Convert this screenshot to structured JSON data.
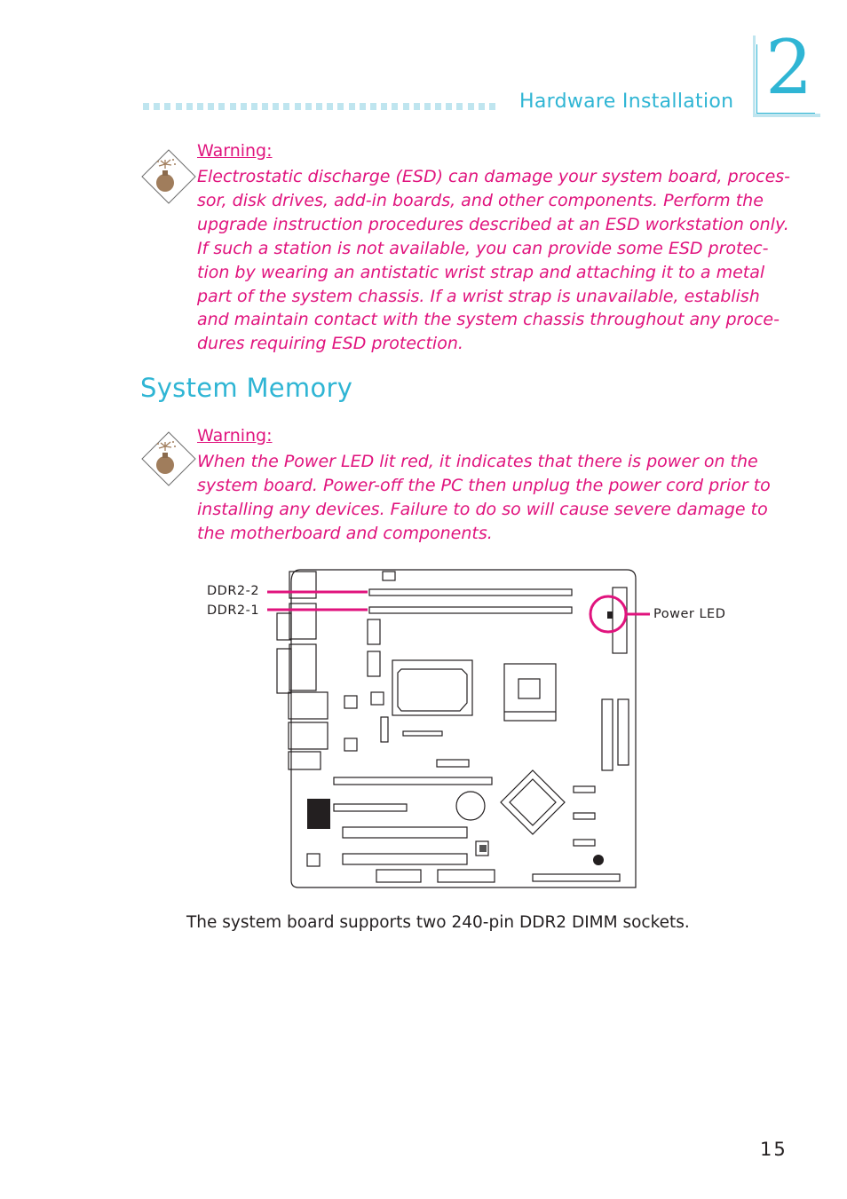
{
  "header": {
    "section_title": "Hardware Installation",
    "chapter_number": "2"
  },
  "warning_esd": {
    "icon": "bomb-warning-icon",
    "title": "Warning:",
    "lines": [
      "Electrostatic discharge (ESD) can damage your system board, proces-",
      "sor, disk drives, add-in boards, and other components. Perform the",
      "upgrade instruction procedures described at an ESD workstation only.",
      "If such a station is not available, you can provide some ESD protec-",
      "tion by wearing an antistatic wrist strap and attaching it to a metal",
      "part of the system chassis. If a wrist strap is unavailable, establish",
      "and maintain contact with the system chassis throughout any proce-",
      "dures requiring ESD protection."
    ]
  },
  "section": {
    "heading": "System Memory"
  },
  "warning_power": {
    "icon": "bomb-warning-icon",
    "title": "Warning:",
    "lines": [
      "When the Power LED lit red, it indicates that there is power on the",
      "system board. Power-off the PC then unplug the power cord prior to",
      "installing any devices. Failure to do so will cause severe damage to",
      "the motherboard and components."
    ]
  },
  "diagram": {
    "labels": {
      "ddr2_2": "DDR2-2",
      "ddr2_1": "DDR2-1",
      "power_led": "Power LED"
    },
    "highlight_color": "#e0137d"
  },
  "caption": "The system board supports two 240-pin DDR2 DIMM sockets.",
  "page_number": "15",
  "colors": {
    "accent_cyan": "#2fb5d4",
    "accent_light": "#bfe5ef",
    "warning_pink": "#e0137d",
    "icon_brown": "#a07d5c"
  }
}
